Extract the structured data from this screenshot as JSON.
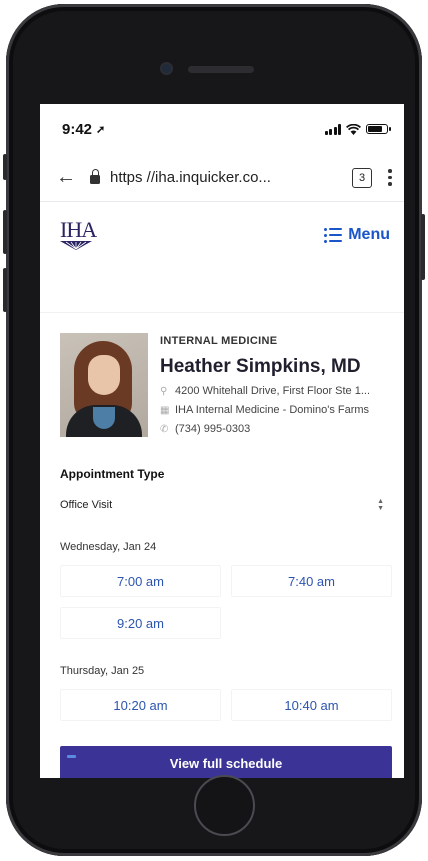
{
  "status_bar": {
    "time": "9:42",
    "location_icon": "location-arrow-icon"
  },
  "browser": {
    "url": "https //iha.inquicker.co...",
    "tab_count": "3"
  },
  "header": {
    "logo_text": "IHA",
    "menu_label": "Menu"
  },
  "provider": {
    "specialty": "INTERNAL MEDICINE",
    "name": "Heather Simpkins, MD",
    "address": "4200 Whitehall Drive, First Floor Ste 1...",
    "location": "IHA Internal Medicine - Domino's Farms",
    "phone": "(734) 995-0303"
  },
  "appointment": {
    "label": "Appointment Type",
    "selected": "Office Visit"
  },
  "days": [
    {
      "label": "Wednesday, Jan 24",
      "slots": [
        "7:00 am",
        "7:40 am",
        "9:20 am"
      ]
    },
    {
      "label": "Thursday, Jan 25",
      "slots": [
        "10:20 am",
        "10:40 am"
      ]
    }
  ],
  "schedule_button": "View full schedule",
  "colors": {
    "brand_navy": "#2a2463",
    "link_blue": "#1a55c9",
    "slot_blue": "#2c55b0",
    "button_purple": "#3c3396"
  }
}
